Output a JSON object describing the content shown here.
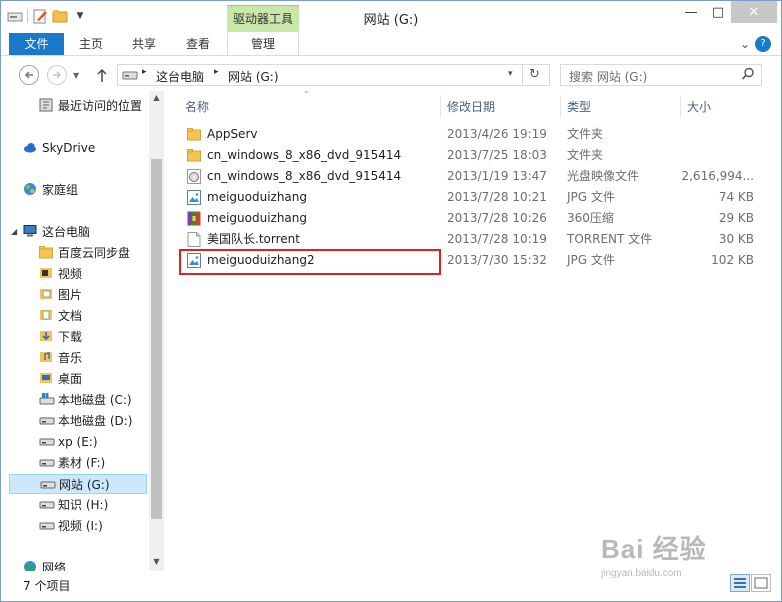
{
  "window": {
    "title": "网站 (G:)",
    "context_tab": "驱动器工具",
    "controls": {
      "minimize": "—",
      "maximize": "□",
      "close": "✕"
    }
  },
  "ribbon": {
    "tabs": [
      "文件",
      "主页",
      "共享",
      "查看",
      "管理"
    ],
    "expand": "⌄",
    "help": "?"
  },
  "address": {
    "path": [
      "这台电脑",
      "网站 (G:)"
    ],
    "search_placeholder": "搜索 网站 (G:)"
  },
  "sidebar": {
    "items": [
      {
        "label": "最近访问的位置",
        "icon": "recent-places-icon"
      },
      {
        "label": "SkyDrive",
        "icon": "skydrive-icon"
      },
      {
        "label": "家庭组",
        "icon": "homegroup-icon"
      },
      {
        "label": "这台电脑",
        "icon": "computer-icon"
      },
      {
        "label": "百度云同步盘",
        "icon": "folder-icon"
      },
      {
        "label": "视频",
        "icon": "videos-icon"
      },
      {
        "label": "图片",
        "icon": "pictures-icon"
      },
      {
        "label": "文档",
        "icon": "documents-icon"
      },
      {
        "label": "下载",
        "icon": "downloads-icon"
      },
      {
        "label": "音乐",
        "icon": "music-icon"
      },
      {
        "label": "桌面",
        "icon": "desktop-icon"
      },
      {
        "label": "本地磁盘 (C:)",
        "icon": "system-drive-icon"
      },
      {
        "label": "本地磁盘 (D:)",
        "icon": "drive-icon"
      },
      {
        "label": "xp (E:)",
        "icon": "drive-icon"
      },
      {
        "label": "素材 (F:)",
        "icon": "drive-icon"
      },
      {
        "label": "网站 (G:)",
        "icon": "drive-icon",
        "selected": true
      },
      {
        "label": "知识 (H:)",
        "icon": "drive-icon"
      },
      {
        "label": "视频 (I:)",
        "icon": "drive-icon"
      },
      {
        "label": "网络",
        "icon": "network-icon"
      }
    ]
  },
  "list": {
    "headers": {
      "name": "名称",
      "date": "修改日期",
      "type": "类型",
      "size": "大小"
    },
    "rows": [
      {
        "name": "AppServ",
        "date": "2013/4/26 19:19",
        "type": "文件夹",
        "size": "",
        "icon": "folder-icon"
      },
      {
        "name": "cn_windows_8_x86_dvd_915414",
        "date": "2013/7/25 18:03",
        "type": "文件夹",
        "size": "",
        "icon": "folder-icon"
      },
      {
        "name": "cn_windows_8_x86_dvd_915414",
        "date": "2013/1/19 13:47",
        "type": "光盘映像文件",
        "size": "2,616,994...",
        "icon": "disc-image-icon"
      },
      {
        "name": "meiguoduizhang",
        "date": "2013/7/28 10:21",
        "type": "JPG 文件",
        "size": "74 KB",
        "icon": "image-file-icon"
      },
      {
        "name": "meiguoduizhang",
        "date": "2013/7/28 10:26",
        "type": "360压缩",
        "size": "29 KB",
        "icon": "archive-icon"
      },
      {
        "name": "美国队长.torrent",
        "date": "2013/7/28 10:19",
        "type": "TORRENT 文件",
        "size": "30 KB",
        "icon": "file-icon"
      },
      {
        "name": "meiguoduizhang2",
        "date": "2013/7/30 15:32",
        "type": "JPG 文件",
        "size": "102 KB",
        "icon": "image-file-icon"
      }
    ]
  },
  "status": {
    "item_count": "7 个项目"
  },
  "watermark": {
    "main": "Bai 经验",
    "sub": "jingyan.baidu.com"
  }
}
